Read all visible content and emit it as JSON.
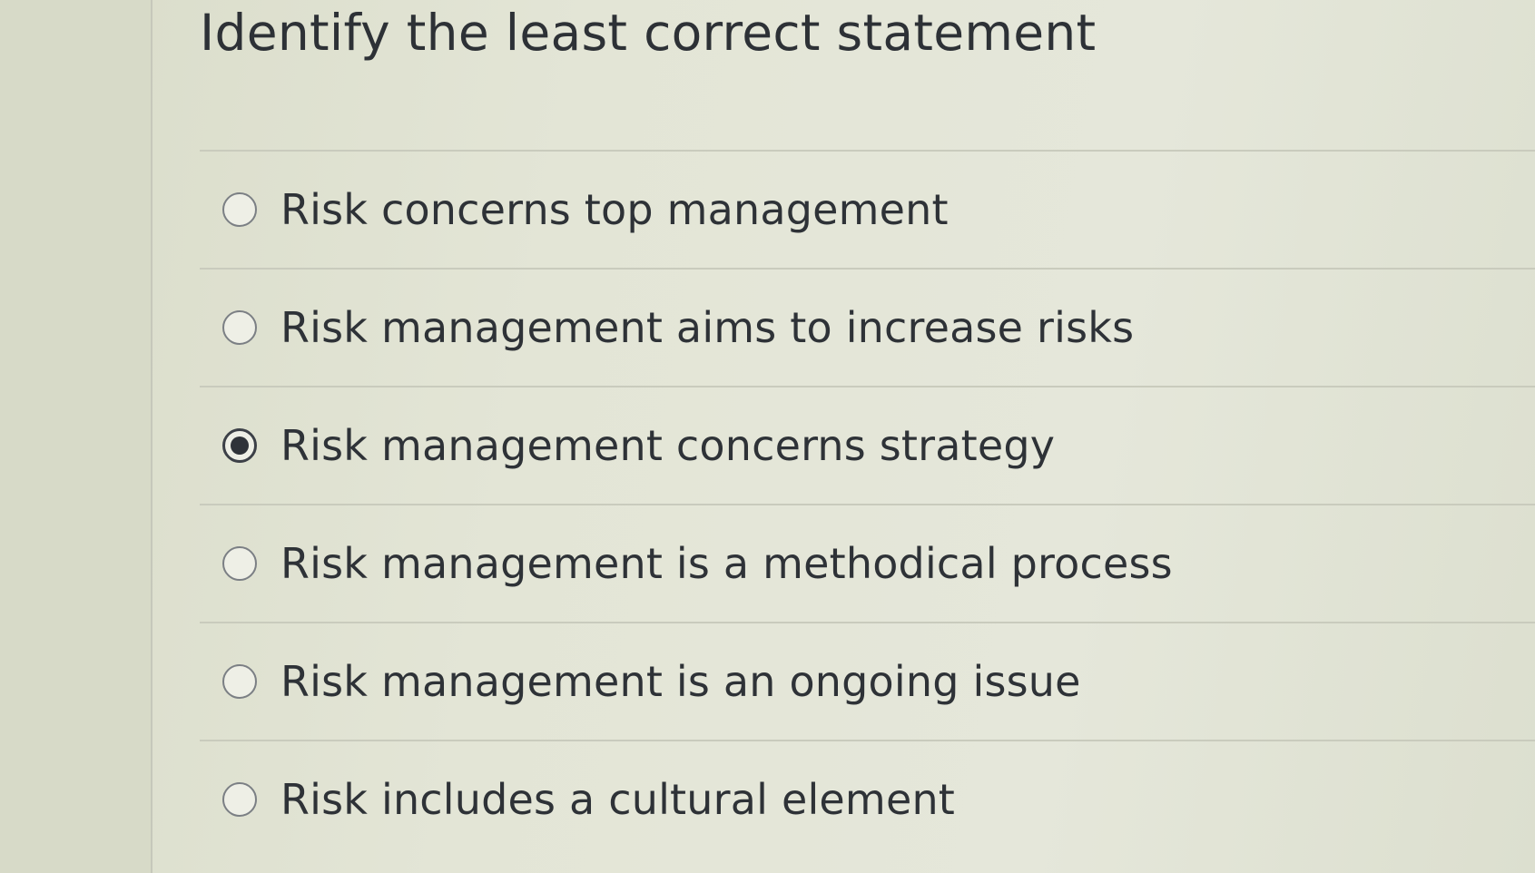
{
  "question": {
    "title": "Identify the least correct statement"
  },
  "options": [
    {
      "label": "Risk concerns top management",
      "selected": false
    },
    {
      "label": "Risk management aims to increase risks",
      "selected": false
    },
    {
      "label": "Risk management concerns strategy",
      "selected": true
    },
    {
      "label": "Risk management is a methodical process",
      "selected": false
    },
    {
      "label": "Risk management is an ongoing issue",
      "selected": false
    },
    {
      "label": "Risk includes a cultural element",
      "selected": false
    }
  ],
  "colors": {
    "background": "#e2e4d5",
    "text": "#2e3237",
    "divider": "#c9cbbd",
    "radio_border": "#7b7f84",
    "radio_selected": "#2f3339"
  }
}
